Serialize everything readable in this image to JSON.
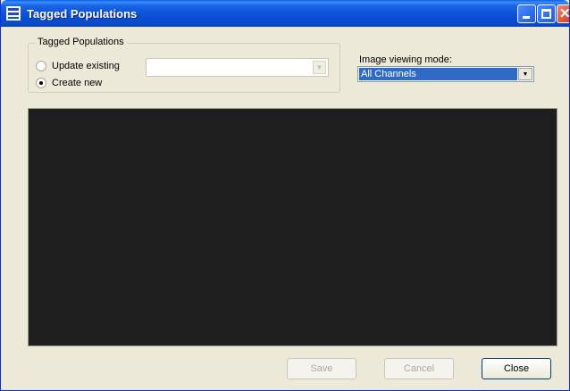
{
  "window": {
    "title": "Tagged Populations",
    "icon": "app-logo-icon",
    "controls": [
      "minimize-icon",
      "maximize-icon",
      "close-icon"
    ],
    "title_bar_color": "#0a4ed4"
  },
  "tagged_populations": {
    "group_label": "Tagged Populations",
    "options": [
      {
        "label": "Update existing",
        "checked": false
      },
      {
        "label": "Create new",
        "checked": true
      }
    ],
    "existing_combo_value": ""
  },
  "image_mode": {
    "label": "Image viewing mode:",
    "selected": "All Channels",
    "selection_color": "#316ac5"
  },
  "viewer": {
    "background": "#1e1e1e"
  },
  "buttons": {
    "save": "Save",
    "cancel": "Cancel",
    "close": "Close"
  }
}
